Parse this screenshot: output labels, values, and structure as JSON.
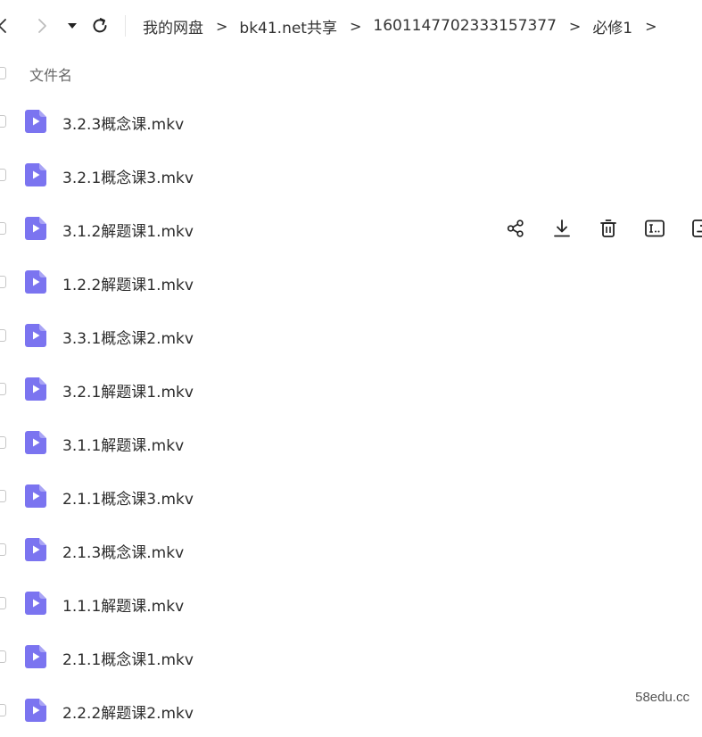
{
  "toolbar": {
    "back_icon": "chevron-left-icon",
    "forward_icon": "chevron-right-icon",
    "history_icon": "caret-down-icon",
    "refresh_icon": "refresh-icon"
  },
  "breadcrumb": {
    "items": [
      "我的网盘",
      "bk41.net共享",
      "1601147702333157377",
      "必修1"
    ],
    "separator": ">"
  },
  "list_header": {
    "name_label": "文件名"
  },
  "files": [
    {
      "name": "3.2.3概念课.mkv"
    },
    {
      "name": "3.2.1概念课3.mkv"
    },
    {
      "name": "3.1.2解题课1.mkv"
    },
    {
      "name": "1.2.2解题课1.mkv"
    },
    {
      "name": "3.3.1概念课2.mkv"
    },
    {
      "name": "3.2.1解题课1.mkv"
    },
    {
      "name": "3.1.1解题课.mkv"
    },
    {
      "name": "2.1.1概念课3.mkv"
    },
    {
      "name": "2.1.3概念课.mkv"
    },
    {
      "name": "1.1.1解题课.mkv"
    },
    {
      "name": "2.1.1概念课1.mkv"
    },
    {
      "name": "2.2.2解题课2.mkv"
    }
  ],
  "hovered_row_actions": [
    "share-icon",
    "download-icon",
    "delete-icon",
    "rename-icon",
    "more-icon"
  ],
  "colors": {
    "file_icon": "#7b74f0",
    "text": "#2c2c2c"
  },
  "watermark": "58edu.cc"
}
